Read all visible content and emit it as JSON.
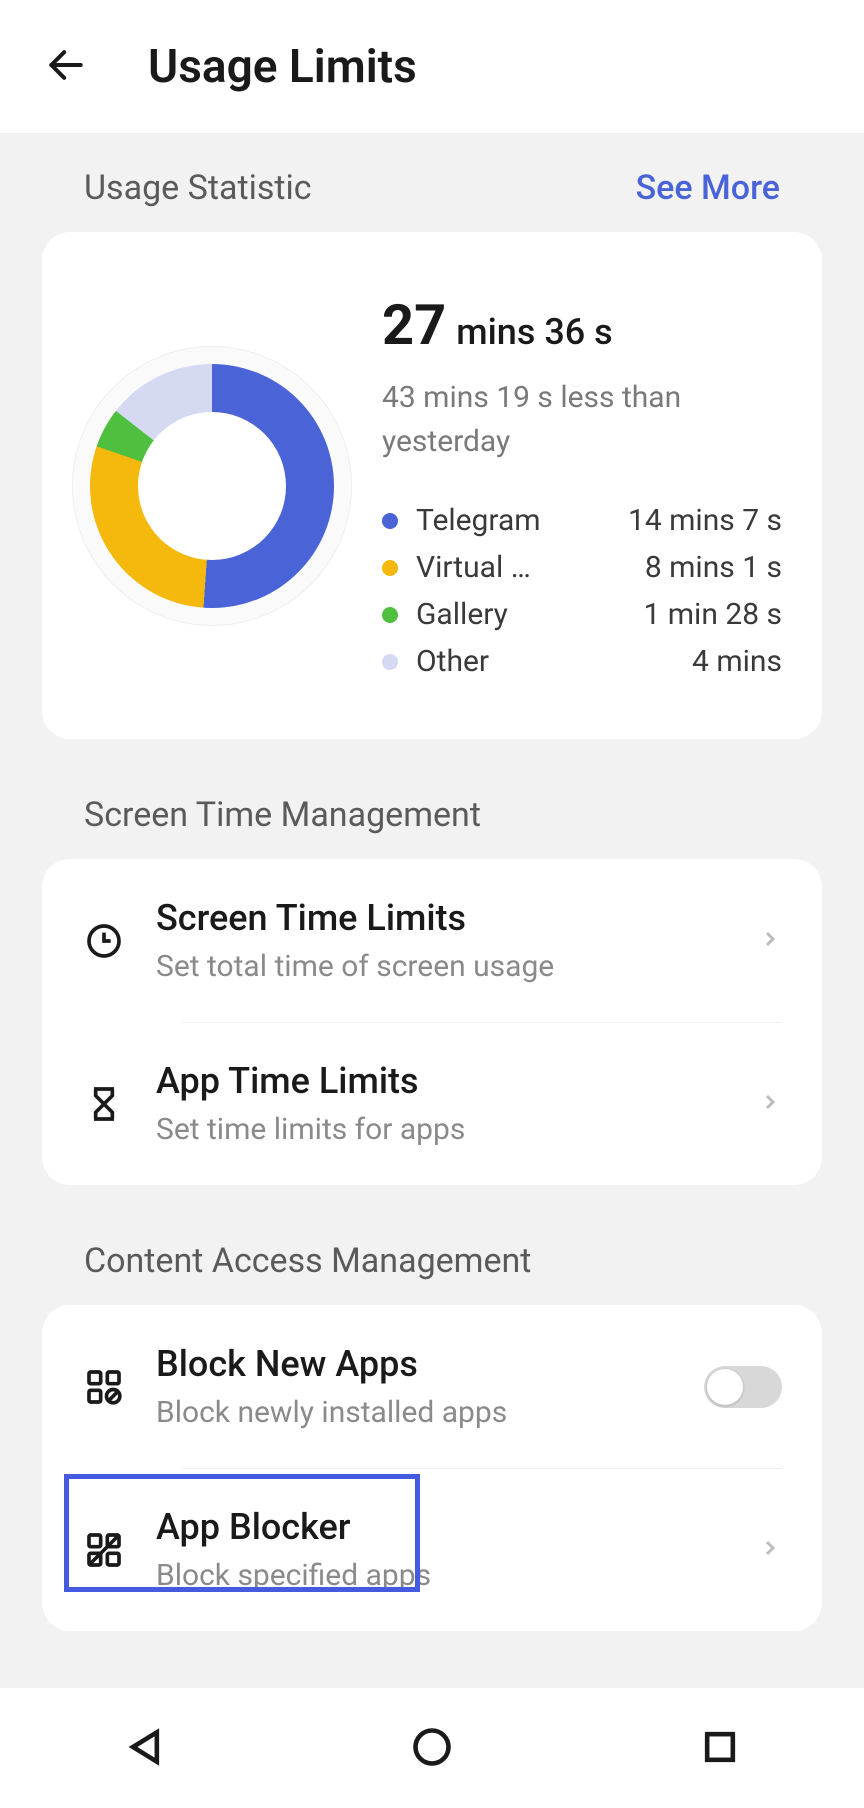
{
  "header": {
    "title": "Usage Limits"
  },
  "sections": {
    "usage": {
      "label": "Usage Statistic",
      "see_more": "See More"
    },
    "screen_time": {
      "label": "Screen Time Management"
    },
    "content_access": {
      "label": "Content Access Management"
    }
  },
  "stats": {
    "total_big": "27",
    "total_rest": "mins 36 s",
    "delta": "43 mins 19 s less than yesterday",
    "legend": [
      {
        "name": "Telegram",
        "value": "14 mins 7 s",
        "color": "#4a63d6"
      },
      {
        "name": "Virtual …",
        "value": "8 mins 1 s",
        "color": "#f5b90e"
      },
      {
        "name": "Gallery",
        "value": "1 min 28 s",
        "color": "#4fbf3f"
      },
      {
        "name": "Other",
        "value": "4 mins",
        "color": "#d5daf2"
      }
    ]
  },
  "items": {
    "screen_limits": {
      "title": "Screen Time Limits",
      "sub": "Set total time of screen usage"
    },
    "app_limits": {
      "title": "App Time Limits",
      "sub": "Set time limits for apps"
    },
    "block_new": {
      "title": "Block New Apps",
      "sub": "Block newly installed apps",
      "toggle": false
    },
    "app_blocker": {
      "title": "App Blocker",
      "sub": "Block specified apps"
    }
  },
  "chart_data": {
    "type": "pie",
    "title": "Today's screen time (27 min 36 s)",
    "series": [
      {
        "name": "Telegram",
        "value_seconds": 847,
        "color": "#4a63d6"
      },
      {
        "name": "Virtual …",
        "value_seconds": 481,
        "color": "#f5b90e"
      },
      {
        "name": "Gallery",
        "value_seconds": 88,
        "color": "#4fbf3f"
      },
      {
        "name": "Other",
        "value_seconds": 240,
        "color": "#d5daf2"
      }
    ]
  }
}
